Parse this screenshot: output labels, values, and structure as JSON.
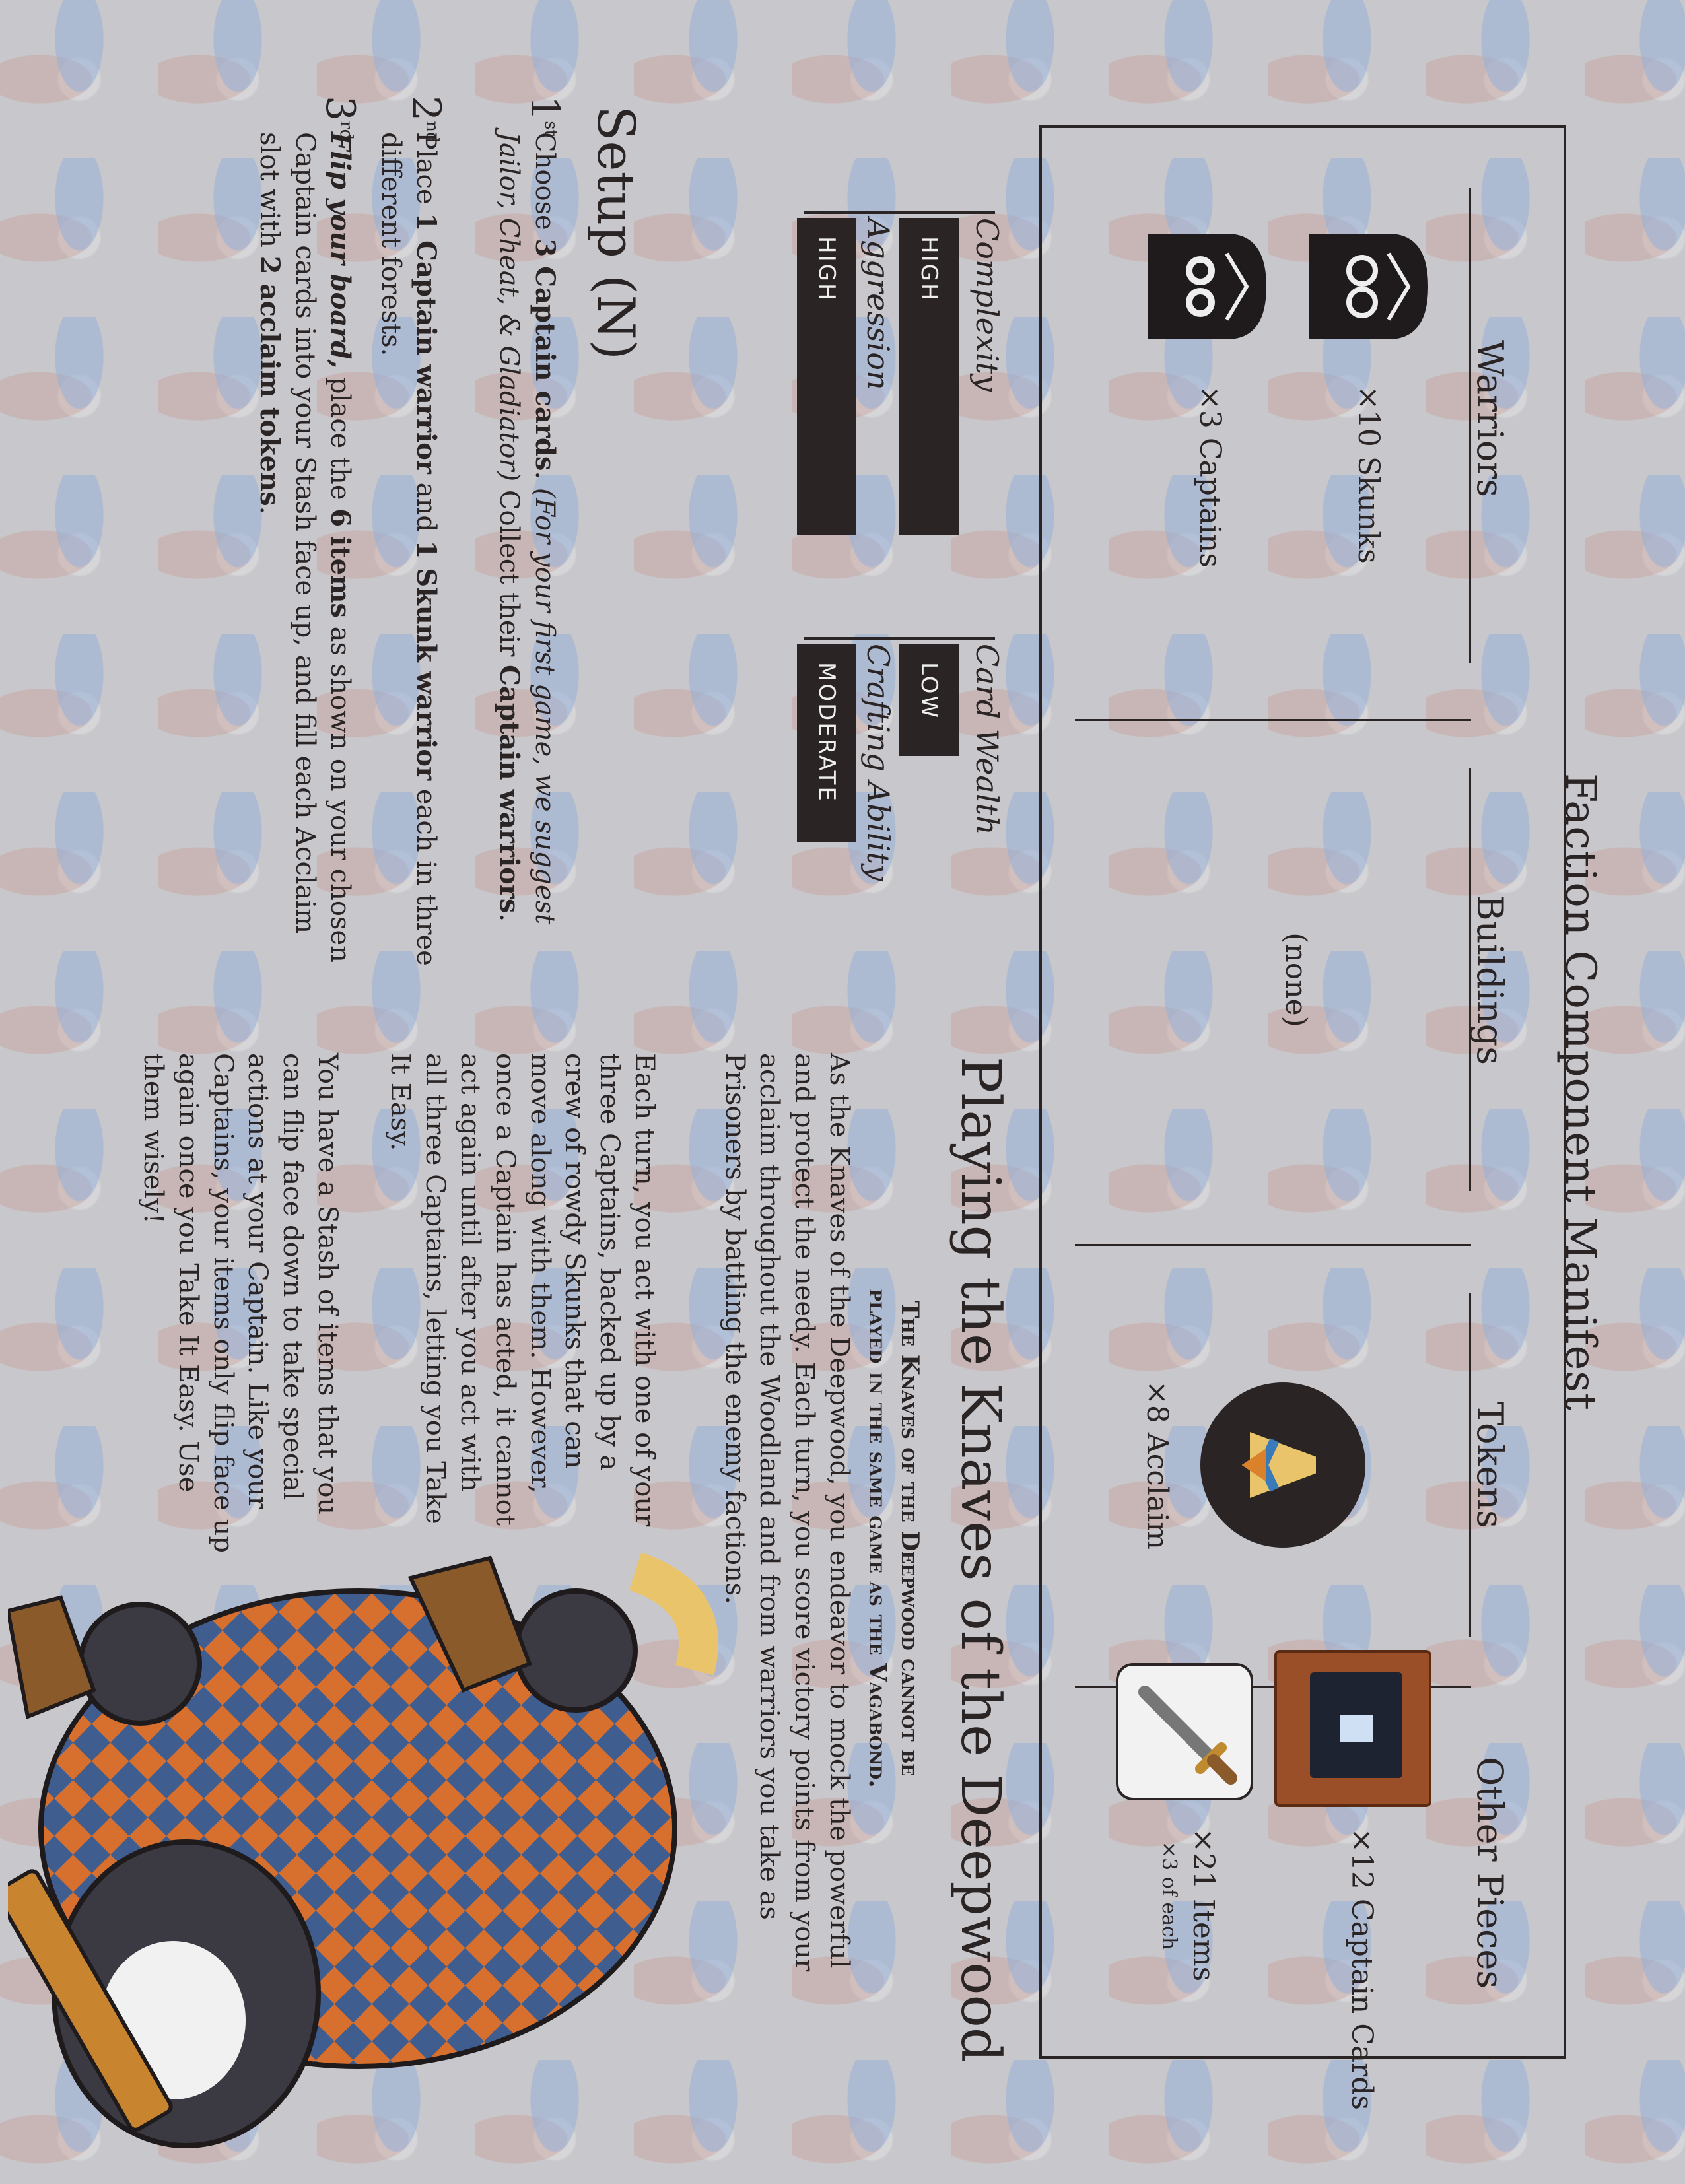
{
  "manifest": {
    "title": "Faction Component Manifest",
    "warriors": {
      "heading": "Warriors",
      "skunks": "×10 Skunks",
      "captains": "×3 Captains"
    },
    "buildings": {
      "heading": "Buildings",
      "none": "(none)"
    },
    "tokens": {
      "heading": "Tokens",
      "acclaim": "×8 Acclaim"
    },
    "other": {
      "heading": "Other Pieces",
      "captain_cards": "×12 Captain Cards",
      "items": "×21 Items",
      "items_note": "×3 of each"
    }
  },
  "playing": {
    "title": "Playing the Knaves of the Deepwood",
    "subtitle_line1": "The Knaves of the Deepwood cannot be",
    "subtitle_line2": "played in the same game as the Vagabond.",
    "intro": "As the Knaves of the Deepwood, you endeavor to mock the powerful and protect the needy. Each turn, you score victory points from your acclaim throughout the Woodland and from warriors you take as Prisoners by battling the enemy factions.",
    "col1": "Each turn, you act with one of your three Captains, backed up by a crew of rowdy Skunks that can move along with them. However, once a Captain has acted, it cannot act again until after you act with all three Captains, letting you Take It Easy.",
    "col2": "You have a Stash of items that you can flip face down to take special actions at your Captain. Like your Captains, your items only flip face up again once you Take It Easy. Use them wisely!"
  },
  "ratings": {
    "complexity": {
      "label": "Complexity",
      "value": "HIGH"
    },
    "aggression": {
      "label": "Aggression",
      "value": "HIGH"
    },
    "card_wealth": {
      "label": "Card Wealth",
      "value": "LOW"
    },
    "crafting": {
      "label": "Crafting Ability",
      "value": "MODERATE"
    }
  },
  "setup": {
    "title": "Setup (N)",
    "step1_num": "1",
    "step1_sup": "st",
    "step1_a": "Choose ",
    "step1_b": "3 Captain cards",
    "step1_c": ". ",
    "step1_d": "(For your first game, we suggest Jailor, Cheat, & Gladiator)",
    "step1_e": " Collect their ",
    "step1_f": "Captain warriors",
    "step1_g": ".",
    "step2_num": "2",
    "step2_sup": "nd",
    "step2_a": "Place ",
    "step2_b": "1 Captain warrior",
    "step2_c": " and ",
    "step2_d": "1 Skunk warrior",
    "step2_e": " each in three different forests.",
    "step3_num": "3",
    "step3_sup": "rd",
    "step3_a": "Flip your board,",
    "step3_b": " place the ",
    "step3_c": "6 items",
    "step3_d": " as shown on your chosen Captain cards into your Stash face up, and fill each Acclaim slot with ",
    "step3_e": "2 acclaim tokens",
    "step3_f": "."
  },
  "colors": {
    "ink": "#2b2425",
    "bar_text": "#eeeeee",
    "pattern_blue": "#96afd7",
    "pattern_red": "#c8968c"
  }
}
